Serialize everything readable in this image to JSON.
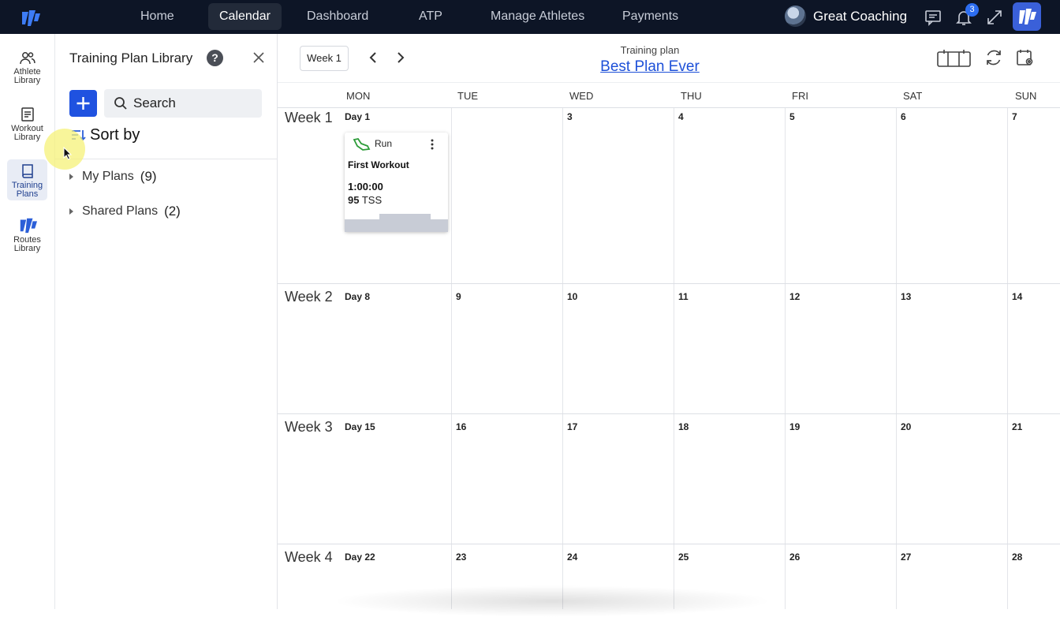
{
  "nav": {
    "items": [
      "Home",
      "Calendar",
      "Dashboard",
      "ATP",
      "Manage Athletes",
      "Payments"
    ],
    "active": "Calendar",
    "user_name": "Great Coaching",
    "notification_count": "3"
  },
  "rail": {
    "items": [
      {
        "label_1": "Athlete",
        "label_2": "Library"
      },
      {
        "label_1": "Workout",
        "label_2": "Library"
      },
      {
        "label_1": "Training",
        "label_2": "Plans"
      },
      {
        "label_1": "Routes",
        "label_2": "Library"
      }
    ],
    "active": "Training Plans"
  },
  "library": {
    "title": "Training Plan Library",
    "help": "?",
    "search_placeholder": "Search",
    "sort_label": "Sort by",
    "folders": [
      {
        "label": "My Plans",
        "count": "(9)"
      },
      {
        "label": "Shared Plans",
        "count": "(2)"
      }
    ]
  },
  "calendar": {
    "week_select": "Week 1",
    "plan_caption": "Training plan",
    "plan_name": "Best Plan Ever",
    "day_headers": [
      "MON",
      "TUE",
      "WED",
      "THU",
      "FRI",
      "SAT",
      "SUN"
    ],
    "weeks": [
      {
        "label": "Week 1",
        "days": [
          "Day 1",
          "",
          "3",
          "4",
          "5",
          "6",
          "7"
        ]
      },
      {
        "label": "Week 2",
        "days": [
          "Day 8",
          "9",
          "10",
          "11",
          "12",
          "13",
          "14"
        ]
      },
      {
        "label": "Week 3",
        "days": [
          "Day 15",
          "16",
          "17",
          "18",
          "19",
          "20",
          "21"
        ]
      },
      {
        "label": "Week 4",
        "days": [
          "Day 22",
          "23",
          "24",
          "25",
          "26",
          "27",
          "28"
        ]
      }
    ]
  },
  "workout": {
    "sport": "Run",
    "title": "First Workout",
    "duration": "1:00:00",
    "tss_value": "95",
    "tss_unit": "TSS"
  },
  "colors": {
    "nav_bg": "#0d1526",
    "accent": "#1f52e0",
    "link": "#1d50d8",
    "run_icon": "#2e9c3a"
  }
}
